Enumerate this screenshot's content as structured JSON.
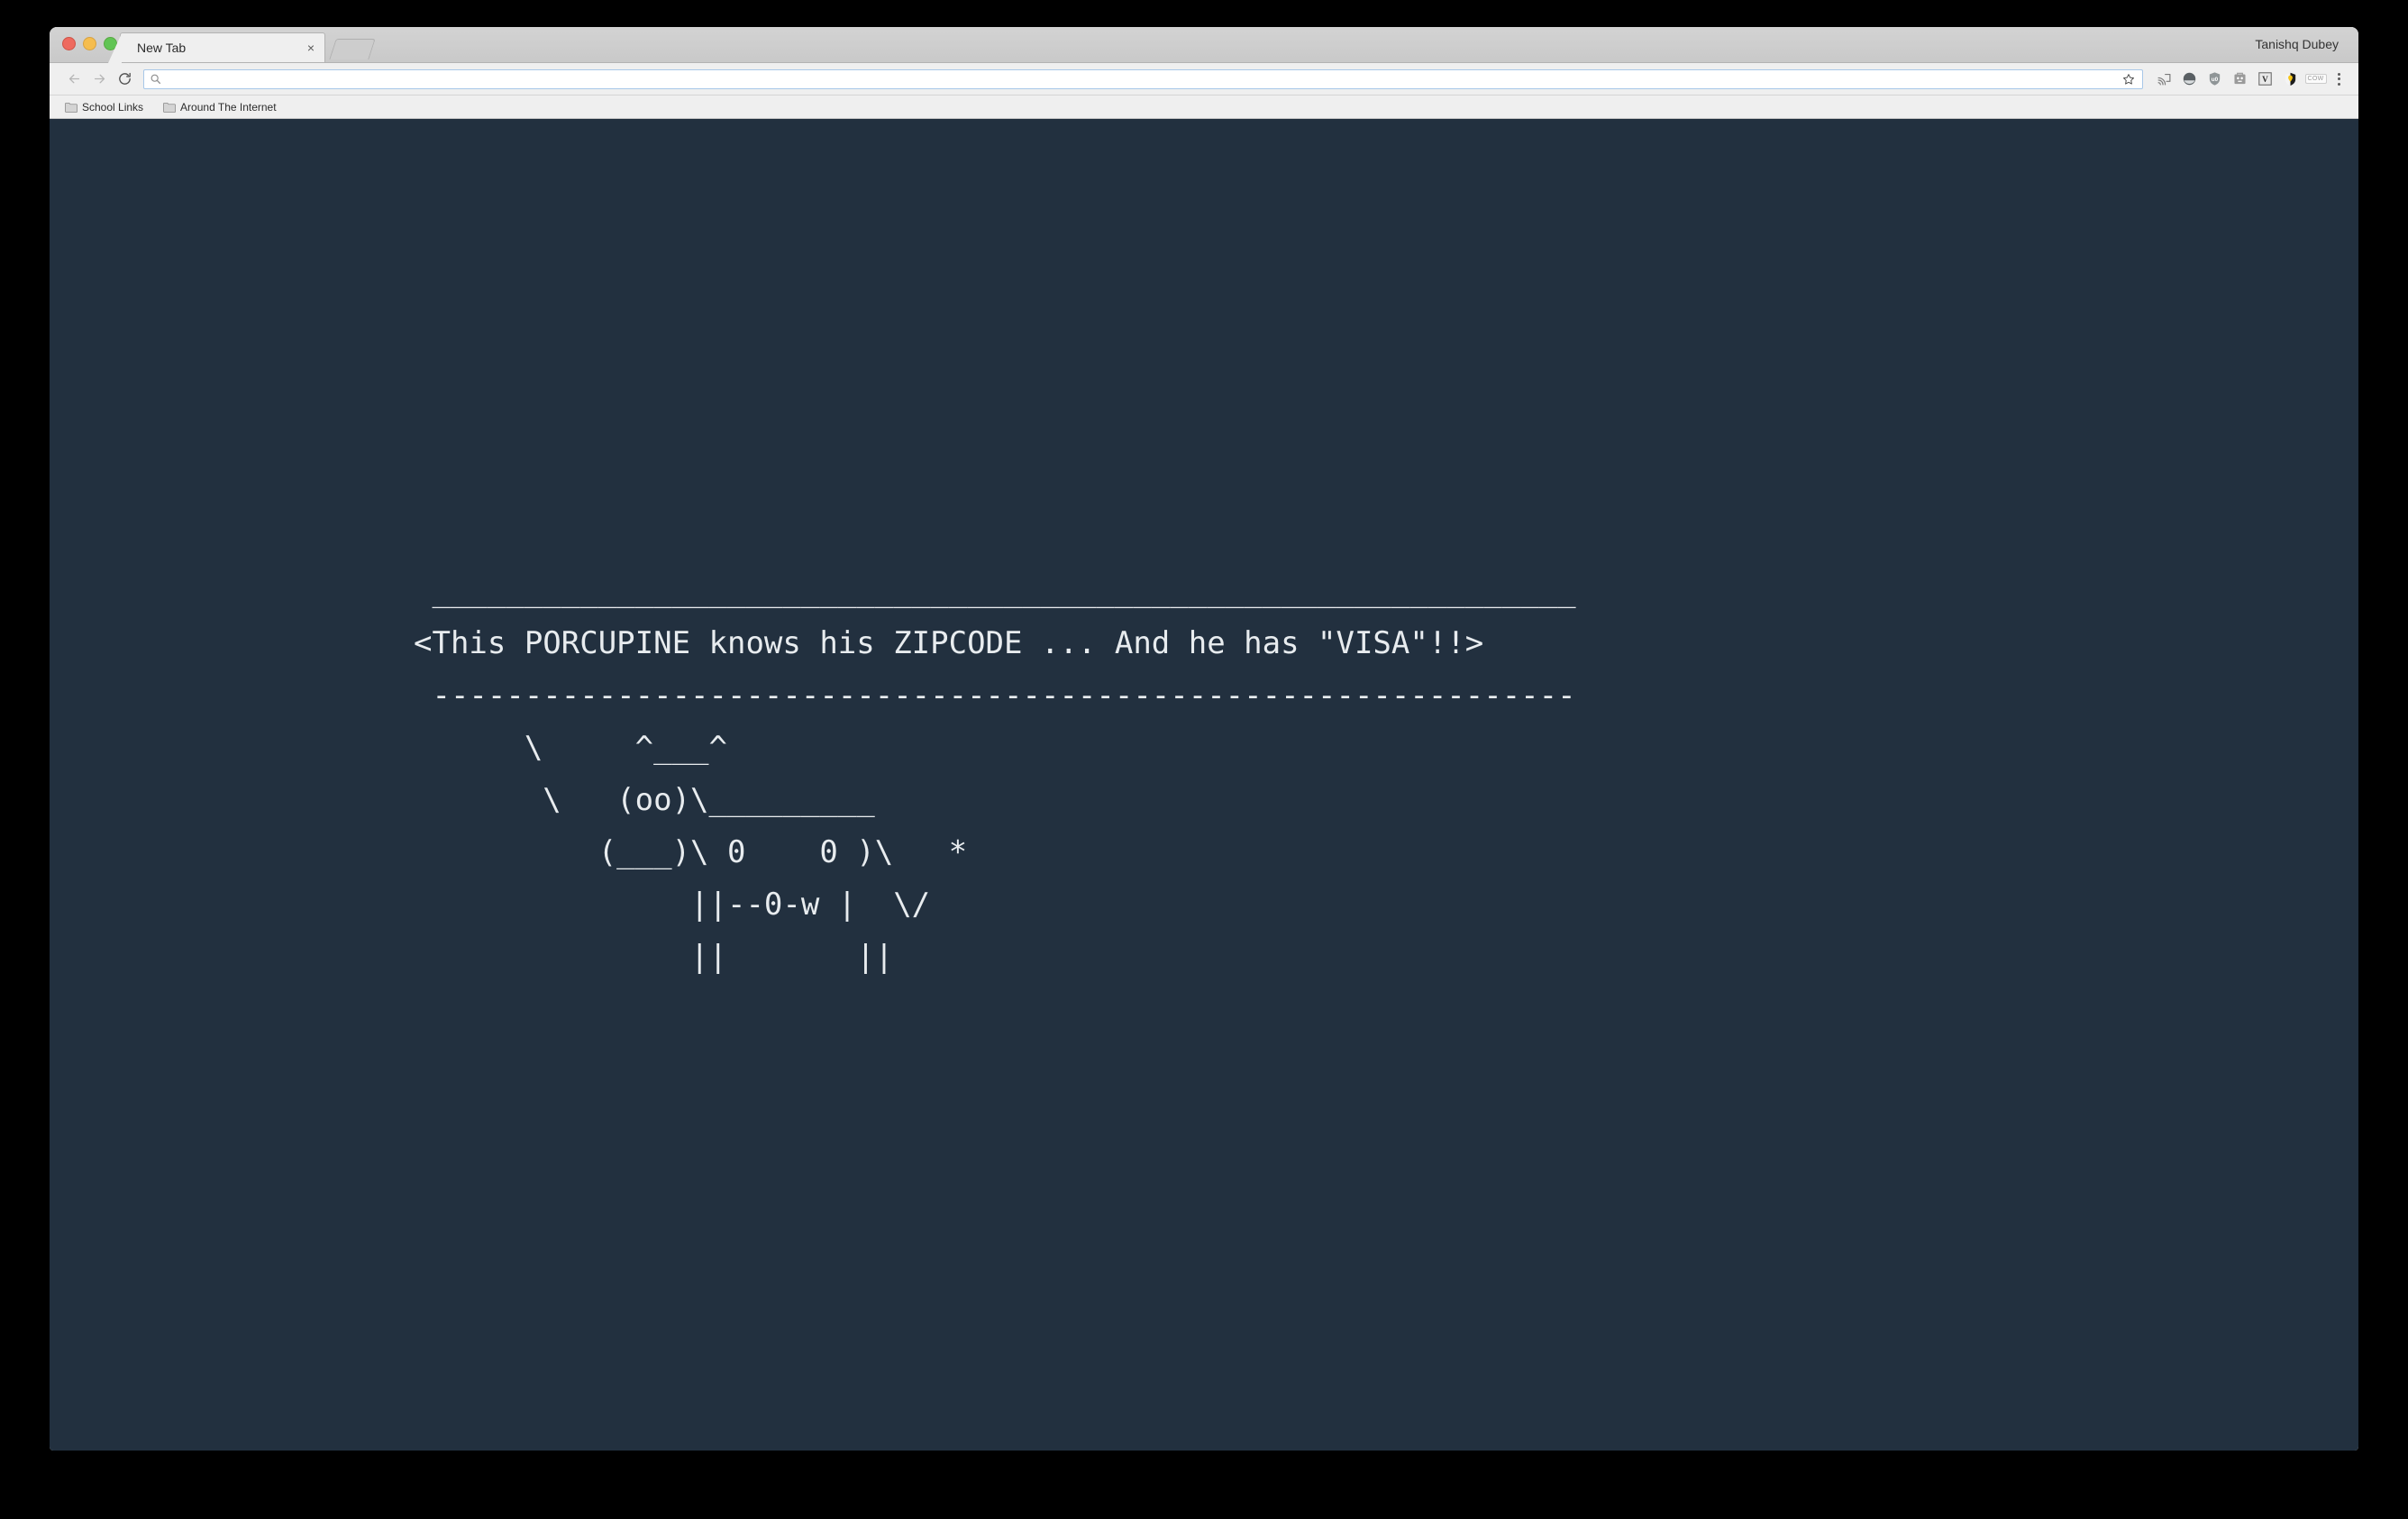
{
  "window": {
    "traffic_lights": [
      "close",
      "minimize",
      "zoom"
    ],
    "profile_name": "Tanishq Dubey"
  },
  "tabstrip": {
    "tabs": [
      {
        "title": "New Tab",
        "close_label": "×",
        "active": true
      }
    ],
    "new_tab_label": "+"
  },
  "toolbar": {
    "back_label": "Back",
    "forward_label": "Forward",
    "reload_label": "Reload",
    "omnibox": {
      "value": "",
      "placeholder": "",
      "search_icon": "search-icon",
      "bookmark_star_icon": "star-icon"
    },
    "extensions": [
      {
        "name": "cast-icon",
        "label": "Cast"
      },
      {
        "name": "dark-circle-extension-icon",
        "label": "Extension"
      },
      {
        "name": "ublock-origin-icon",
        "label": "uBlock Origin"
      },
      {
        "name": "grey-face-extension-icon",
        "label": "Extension"
      },
      {
        "name": "vimium-icon",
        "label": "Vimium"
      },
      {
        "name": "honey-icon",
        "label": "Honey"
      },
      {
        "name": "cow-extension-icon",
        "label": "COW"
      }
    ],
    "menu_label": "Customize and control Google Chrome"
  },
  "bookmarks_bar": {
    "items": [
      {
        "label": "School Links",
        "icon": "folder-icon"
      },
      {
        "label": "Around The Internet",
        "icon": "folder-icon"
      }
    ]
  },
  "page": {
    "background_color": "#22303f",
    "text_color": "#e8ecef",
    "ascii_art": " ______________________________________________________________\n<This PORCUPINE knows his ZIPCODE ... And he has \"VISA\"!!>\n --------------------------------------------------------------\n      \\     ^___^\n       \\   (oo)\\_________\n          (___)\\ 0    0 )\\   *\n               ||--0-w |  \\/\n               ||       ||",
    "headline": "<This PORCUPINE knows his ZIPCODE ... And he has \"VISA\"!!>"
  }
}
